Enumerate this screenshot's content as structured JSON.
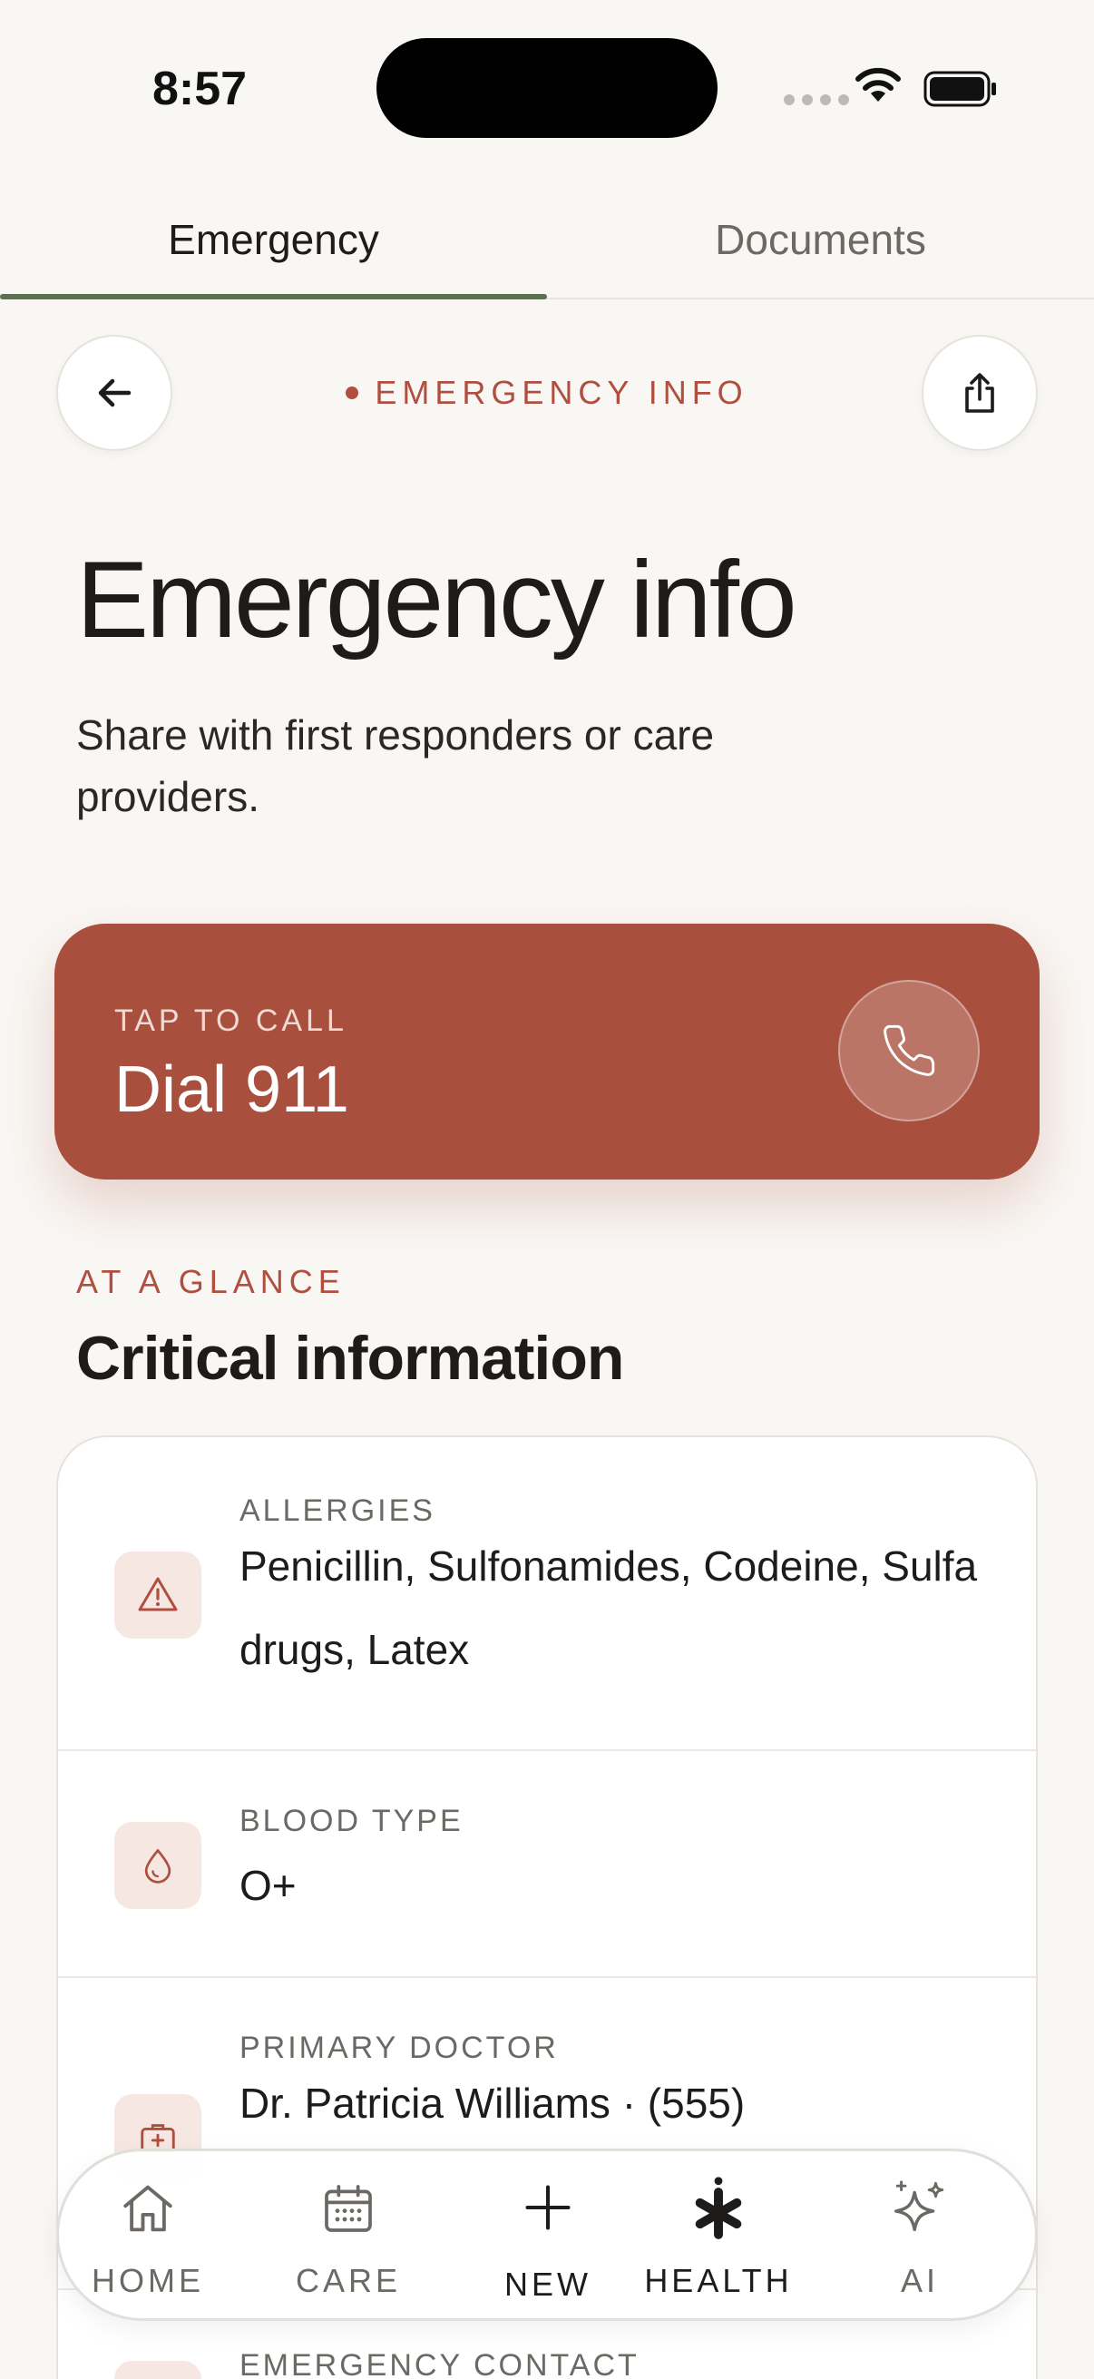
{
  "status_bar": {
    "time": "8:57"
  },
  "top_tabs": [
    {
      "label": "Emergency",
      "active": true
    },
    {
      "label": "Documents",
      "active": false
    }
  ],
  "header": {
    "eyebrow": "EMERGENCY INFO"
  },
  "page": {
    "title": "Emergency info",
    "subtitle": "Share with first responders or care providers."
  },
  "call_card": {
    "eyebrow": "TAP TO CALL",
    "title": "Dial 911"
  },
  "section": {
    "eyebrow": "AT A GLANCE",
    "title": "Critical information"
  },
  "info_rows": [
    {
      "label": "ALLERGIES",
      "value": "Penicillin, Sulfonamides, Codeine, Sulfa drugs, Latex",
      "icon": "warning-icon"
    },
    {
      "label": "BLOOD TYPE",
      "value": "O+",
      "icon": "blood-drop-icon"
    },
    {
      "label": "PRIMARY DOCTOR",
      "value": "Dr. Patricia Williams · (555)",
      "icon": "medical-kit-icon"
    },
    {
      "label": "EMERGENCY CONTACT",
      "value": "",
      "icon": "contact-icon"
    }
  ],
  "bottom_nav": [
    {
      "label": "HOME",
      "icon": "home-icon"
    },
    {
      "label": "CARE",
      "icon": "calendar-icon"
    },
    {
      "label": "NEW",
      "icon": "plus-icon"
    },
    {
      "label": "HEALTH",
      "icon": "asterisk-icon"
    },
    {
      "label": "AI",
      "icon": "sparkle-icon"
    }
  ],
  "colors": {
    "accent": "#a84f3d",
    "tab_indicator": "#5a7050",
    "background": "#f9f7f4"
  }
}
